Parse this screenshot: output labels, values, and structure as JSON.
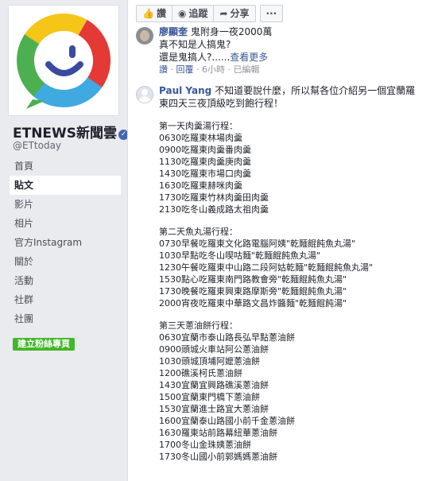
{
  "sidebar": {
    "page_name": "ETNEWS新聞雲",
    "handle": "@ETtoday",
    "nav": [
      "首頁",
      "貼文",
      "影片",
      "相片",
      "官方Instagram",
      "關於",
      "活動",
      "社群",
      "社團"
    ],
    "active_nav": "貼文",
    "create_button": "建立粉絲專頁",
    "colors": {
      "accent": "#4267b2",
      "green": "#42b72a"
    }
  },
  "actions": {
    "like": "讚",
    "follow": "追蹤",
    "share": "分享",
    "more": "···"
  },
  "comment1": {
    "author": "廖顯奎",
    "lines": [
      "鬼附身一夜2000萬",
      "真不知是人搞鬼?",
      "還是鬼搞人?......"
    ],
    "see_more": "查看更多",
    "like": "讚",
    "reply": "回覆",
    "time": "6小時",
    "edited": "已編輯"
  },
  "comment2": {
    "author": "Paul Yang",
    "intro_1": "不知道要說什麼，所以幫各位介紹另一個宜蘭羅",
    "intro_2": "東四天三夜頂級吃到飽行程！",
    "days": [
      {
        "title": "第一天肉羹湯行程：",
        "items": [
          "0630吃羅東林場肉羹",
          "0900吃羅東肉羹番肉羹",
          "1130吃羅東肉羹庚肉羹",
          "1430吃羅東市場口肉羹",
          "1630吃羅東赫咪肉羹",
          "1730吃羅東竹林肉羹田肉羹",
          "2130吃冬山義成路太祖肉羹"
        ]
      },
      {
        "title": "第二天魚丸湯行程：",
        "items": [
          "0730早餐吃羅東文化路電腦阿姨\"乾麵餛飩魚丸湯\"",
          "1030早點吃冬山喫咕麵\"乾麵餛飩魚丸湯\"",
          "1230午餐吃羅東中山路二段阿姑乾麵\"乾麵餛飩魚丸湯\"",
          "1530點心吃羅東南門路教會旁\"乾麵餛飩魚丸湯\"",
          "1730晚餐吃羅東興東路摩斯旁\"乾麵餛飩魚丸湯\"",
          "2000宵夜吃羅東中華路文昌炸醬麵\"乾麵餛飩湯\""
        ]
      },
      {
        "title": "第三天蔥油餅行程：",
        "items": [
          "0630宜蘭市泰山路長弘早點蔥油餅",
          "0900頭城火車站阿公蔥油餅",
          "1030頭城頂埔阿嬤蔥油餅",
          "1200礁溪柯氏蔥油餅",
          "1430宜蘭宜興路礁溪蔥油餅",
          "1500宜蘭東門橋下蔥油餅",
          "1530宜蘭進士路宜大蔥油餅",
          "1600宜蘭泰山路國小前千金蔥油餅",
          "1630羅東站前路幕紐華蔥油餅",
          "1700冬山金珠姨蔥油餅",
          "1730冬山國小前郭媽媽蔥油餅"
        ]
      }
    ]
  }
}
